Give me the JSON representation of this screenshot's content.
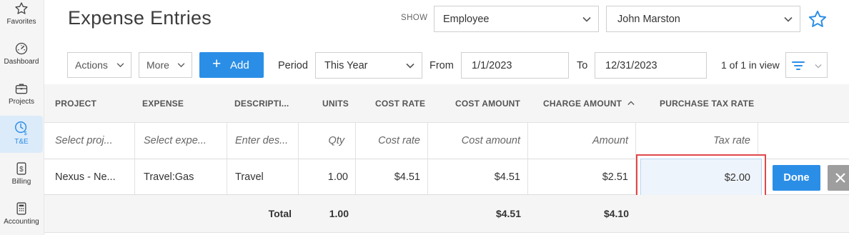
{
  "sidebar": {
    "items": [
      {
        "label": "Favorites",
        "icon": "star-icon"
      },
      {
        "label": "Dashboard",
        "icon": "gauge-icon"
      },
      {
        "label": "Projects",
        "icon": "briefcase-icon"
      },
      {
        "label": "T&E",
        "icon": "clock-dollar-icon",
        "active": true
      },
      {
        "label": "Billing",
        "icon": "dollar-doc-icon"
      },
      {
        "label": "Accounting",
        "icon": "calculator-icon"
      }
    ]
  },
  "header": {
    "title": "Expense Entries",
    "show_label": "SHOW",
    "show_type": "Employee",
    "employee": "John Marston",
    "favorite_icon": "star-outline-icon"
  },
  "toolbar": {
    "actions_label": "Actions",
    "more_label": "More",
    "add_label": "Add",
    "period_label": "Period",
    "period_value": "This Year",
    "from_label": "From",
    "from_value": "1/1/2023",
    "to_label": "To",
    "to_value": "12/31/2023",
    "in_view": "1 of 1 in view",
    "filter_icon": "filter-lines-icon"
  },
  "grid": {
    "columns": [
      "PROJECT",
      "EXPENSE",
      "DESCRIPTI...",
      "UNITS",
      "COST RATE",
      "COST AMOUNT",
      "CHARGE AMOUNT",
      "PURCHASE TAX RATE"
    ],
    "sort_column": "CHARGE AMOUNT",
    "sort_direction": "ascending",
    "filter_placeholders": [
      "Select proj...",
      "Select expe...",
      "Enter des...",
      "Qty",
      "Cost rate",
      "Cost amount",
      "Amount",
      "Tax rate"
    ],
    "rows": [
      {
        "project": "Nexus - Ne...",
        "expense": "Travel:Gas",
        "description": "Travel",
        "units": "1.00",
        "cost_rate": "$4.51",
        "cost_amount": "$4.51",
        "charge_amount": "$2.51",
        "tax_rate": "$2.00"
      }
    ],
    "totals": {
      "label": "Total",
      "units": "1.00",
      "cost_amount": "$4.51",
      "charge_amount": "$4.10"
    },
    "done_label": "Done"
  },
  "colors": {
    "accent": "#2b8ee6",
    "highlight_border": "#e0484a",
    "sidebar_active": "#dcebfa"
  }
}
